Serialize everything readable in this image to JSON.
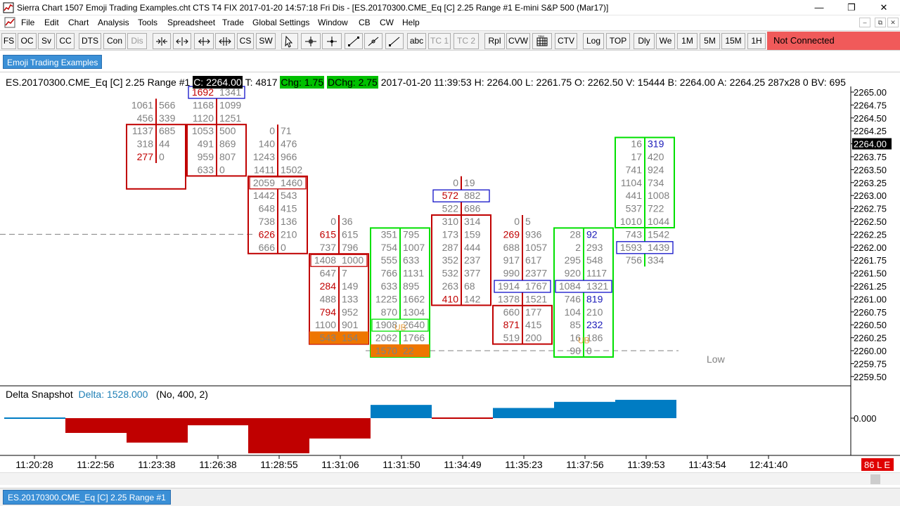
{
  "window": {
    "title": "Sierra Chart 1507 Emoji Trading Examples.cht  CTS T4 FIX 2017-01-20  14:57:18 Fri  Dis - [ES.20170300.CME_Eq [C]  2.25 Range  #1  E-mini S&P 500 (Mar17)]",
    "minimize": "—",
    "maximize": "❐",
    "close": "✕"
  },
  "menu": [
    "File",
    "Edit",
    "Chart",
    "Analysis",
    "Tools",
    "Spreadsheet",
    "Trade",
    "Global Settings",
    "Window",
    "CB",
    "CW",
    "Help"
  ],
  "mdi_controls": [
    "–",
    "⧉",
    "✕"
  ],
  "toolbar": {
    "buttons": [
      "FS",
      "OC",
      "Sv",
      "CC",
      "DTS",
      "Con",
      "Dis",
      "CS",
      "SW",
      "abc",
      "TC 1",
      "TC 2",
      "Rpl",
      "CVW",
      "CTV",
      "Log",
      "TOP",
      "Dly",
      "We",
      "1M",
      "5M",
      "15M",
      "1H"
    ],
    "disabled": [
      "Dis",
      "TC 1",
      "TC 2"
    ],
    "status": "Not Connected"
  },
  "chart_tab": "Emoji Trading Examples",
  "bottom_tab": "ES.20170300.CME_Eq [C]  2.25 Range  #1",
  "header": {
    "symbol": "ES.20170300.CME_Eq [C]  2.25 Range  #1",
    "close": "C: 2264.00",
    "trades": "T: 4817",
    "chg": "Chg: 1.75",
    "dchg": "DChg: 2.75",
    "rest": "2017-01-20 11:39:53 H: 2264.00 L: 2261.75 O: 2262.50 V: 15444 B: 2264.00 A: 2264.25 287x28 0 BV: 695"
  },
  "delta": {
    "title": "Delta Snapshot",
    "value": "Delta: 1528.000",
    "params": "(No, 400, 2)",
    "zero_label": "0.000"
  },
  "low_label": "Low",
  "right_badge": "86 L E",
  "colors": {
    "red": "#c00000",
    "green": "#00e000",
    "blue_box": "#1010c8",
    "blue_bar": "#007cc3",
    "orange": "#ee7600",
    "grey": "#808080",
    "blue_text": "#1a1ab8",
    "status_red": "#f05a5a"
  },
  "chart_data": {
    "type": "footprint",
    "price_axis": {
      "tick_labels": [
        "2265.00",
        "2264.75",
        "2264.50",
        "2264.25",
        "2264.00",
        "2263.75",
        "2263.50",
        "2263.25",
        "2263.00",
        "2262.75",
        "2262.50",
        "2262.25",
        "2262.00",
        "2261.75",
        "2261.50",
        "2261.25",
        "2261.00",
        "2260.75",
        "2260.50",
        "2260.25",
        "2260.00",
        "2259.75",
        "2259.50"
      ],
      "range": [
        2259.5,
        2265.0
      ],
      "step": 0.25,
      "current_price": "2264.00"
    },
    "time_axis": {
      "tick_labels": [
        "11:20:28",
        "11:22:56",
        "11:23:38",
        "11:26:38",
        "11:28:55",
        "11:31:06",
        "11:31:50",
        "11:34:49",
        "11:35:23",
        "11:37:56",
        "11:39:53",
        "11:43:54",
        "12:41:40"
      ]
    },
    "dashed_lines": [
      2262.25,
      2260.0
    ],
    "bars": [
      {
        "open": 2264.0,
        "close": 2264.25,
        "boxcolor": "red",
        "rows": [
          [
            "1061",
            "566"
          ],
          [
            "456",
            "339"
          ],
          [
            "1137",
            "685"
          ],
          [
            "318",
            "44"
          ],
          [
            "277",
            "0"
          ]
        ],
        "high": 2265.0,
        "colors": [
          [
            "g",
            "g"
          ],
          [
            "g",
            "g"
          ],
          [
            "g",
            "g"
          ],
          [
            "g",
            "g"
          ],
          [
            "r",
            "g"
          ]
        ],
        "boxes": []
      },
      {
        "high": 2265.0,
        "rows": [
          [
            "1692",
            "1341"
          ],
          [
            "1168",
            "1099"
          ],
          [
            "1120",
            "1251"
          ],
          [
            "1053",
            "500"
          ],
          [
            "491",
            "869"
          ],
          [
            "959",
            "807"
          ],
          [
            "633",
            "0"
          ]
        ],
        "colors": [
          [
            "r",
            "g"
          ],
          [
            "g",
            "g"
          ],
          [
            "g",
            "g"
          ],
          [
            "g",
            "g"
          ],
          [
            "g",
            "g"
          ],
          [
            "g",
            "g"
          ],
          [
            "g",
            "g"
          ]
        ],
        "body": [
          2264.25,
          2263.5
        ],
        "boxcolor": "red",
        "boxes": [
          {
            "row": 0,
            "color": "blue"
          }
        ]
      },
      {
        "high": 2264.25,
        "rows": [
          [
            "0",
            "71"
          ],
          [
            "140",
            "476"
          ],
          [
            "1243",
            "966"
          ],
          [
            "1411",
            "1502"
          ],
          [
            "2059",
            "1460"
          ],
          [
            "1442",
            "543"
          ],
          [
            "648",
            "415"
          ],
          [
            "738",
            "136"
          ],
          [
            "626",
            "210"
          ],
          [
            "666",
            "0"
          ]
        ],
        "colors": [
          [
            "g",
            "g"
          ],
          [
            "g",
            "g"
          ],
          [
            "g",
            "g"
          ],
          [
            "g",
            "g"
          ],
          [
            "g",
            "g"
          ],
          [
            "g",
            "g"
          ],
          [
            "g",
            "g"
          ],
          [
            "g",
            "g"
          ],
          [
            "r",
            "g"
          ],
          [
            "g",
            "g"
          ]
        ],
        "body": [
          2263.25,
          2262.0
        ],
        "boxcolor": "red",
        "boxes": [
          {
            "row": 4,
            "color": "red"
          }
        ]
      },
      {
        "high": 2262.5,
        "rows": [
          [
            "0",
            "36"
          ],
          [
            "615",
            "615"
          ],
          [
            "737",
            "796"
          ],
          [
            "1408",
            "1000"
          ],
          [
            "647",
            "7"
          ],
          [
            "284",
            "149"
          ],
          [
            "488",
            "133"
          ],
          [
            "794",
            "952"
          ],
          [
            "1100",
            "901"
          ],
          [
            "543",
            "154"
          ]
        ],
        "colors": [
          [
            "g",
            "g"
          ],
          [
            "r",
            "g"
          ],
          [
            "g",
            "g"
          ],
          [
            "g",
            "g"
          ],
          [
            "g",
            "g"
          ],
          [
            "r",
            "g"
          ],
          [
            "g",
            "g"
          ],
          [
            "r",
            "g"
          ],
          [
            "g",
            "g"
          ],
          [
            "g",
            "g"
          ]
        ],
        "body": [
          2261.75,
          2260.25
        ],
        "boxcolor": "red",
        "boxes": [
          {
            "row": 3,
            "color": "red"
          }
        ],
        "orange_row": 9
      },
      {
        "high": 2262.25,
        "rows": [
          [
            "351",
            "795"
          ],
          [
            "754",
            "1007"
          ],
          [
            "555",
            "633"
          ],
          [
            "766",
            "1131"
          ],
          [
            "633",
            "895"
          ],
          [
            "1225",
            "1662"
          ],
          [
            "870",
            "1304"
          ],
          [
            "1908",
            "2640"
          ],
          [
            "2062",
            "1766"
          ],
          [
            "1570",
            "22"
          ]
        ],
        "colors": [
          [
            "g",
            "g"
          ],
          [
            "g",
            "g"
          ],
          [
            "g",
            "g"
          ],
          [
            "g",
            "g"
          ],
          [
            "g",
            "g"
          ],
          [
            "g",
            "g"
          ],
          [
            "g",
            "g"
          ],
          [
            "g",
            "g"
          ],
          [
            "g",
            "g"
          ],
          [
            "g",
            "g"
          ]
        ],
        "body": [
          2262.25,
          2260.0
        ],
        "boxcolor": "green",
        "boxes": [
          {
            "row": 7,
            "color": "green"
          }
        ],
        "orange_row": 9,
        "ub_row": 7
      },
      {
        "high": 2263.25,
        "rows": [
          [
            "0",
            "19"
          ],
          [
            "572",
            "882"
          ],
          [
            "522",
            "686"
          ],
          [
            "310",
            "314"
          ],
          [
            "173",
            "159"
          ],
          [
            "287",
            "444"
          ],
          [
            "352",
            "237"
          ],
          [
            "532",
            "377"
          ],
          [
            "263",
            "68"
          ],
          [
            "410",
            "142"
          ]
        ],
        "colors": [
          [
            "g",
            "g"
          ],
          [
            "r",
            "g"
          ],
          [
            "g",
            "g"
          ],
          [
            "g",
            "g"
          ],
          [
            "g",
            "g"
          ],
          [
            "g",
            "g"
          ],
          [
            "g",
            "g"
          ],
          [
            "g",
            "g"
          ],
          [
            "g",
            "g"
          ],
          [
            "r",
            "g"
          ]
        ],
        "body": [
          2262.5,
          2261.0
        ],
        "boxcolor": "red",
        "boxes": [
          {
            "row": 1,
            "color": "blue"
          }
        ]
      },
      {
        "high": 2262.5,
        "rows": [
          [
            "0",
            "5"
          ],
          [
            "269",
            "936"
          ],
          [
            "688",
            "1057"
          ],
          [
            "917",
            "617"
          ],
          [
            "990",
            "2377"
          ],
          [
            "1914",
            "1767"
          ],
          [
            "1378",
            "1521"
          ],
          [
            "660",
            "177"
          ],
          [
            "871",
            "415"
          ],
          [
            "519",
            "200"
          ]
        ],
        "colors": [
          [
            "g",
            "g"
          ],
          [
            "r",
            "g"
          ],
          [
            "g",
            "g"
          ],
          [
            "g",
            "g"
          ],
          [
            "g",
            "g"
          ],
          [
            "g",
            "g"
          ],
          [
            "g",
            "g"
          ],
          [
            "g",
            "g"
          ],
          [
            "r",
            "g"
          ],
          [
            "g",
            "g"
          ]
        ],
        "body": [
          2260.75,
          2260.25
        ],
        "boxcolor": "red",
        "boxes": [
          {
            "row": 5,
            "color": "blue"
          }
        ]
      },
      {
        "high": 2262.25,
        "rows": [
          [
            "28",
            "92"
          ],
          [
            "2",
            "293"
          ],
          [
            "295",
            "548"
          ],
          [
            "920",
            "1117"
          ],
          [
            "1084",
            "1321"
          ],
          [
            "746",
            "819"
          ],
          [
            "104",
            "210"
          ],
          [
            "85",
            "232"
          ],
          [
            "16",
            "186"
          ],
          [
            "90",
            "0"
          ]
        ],
        "colors": [
          [
            "g",
            "b"
          ],
          [
            "g",
            "g"
          ],
          [
            "g",
            "g"
          ],
          [
            "g",
            "g"
          ],
          [
            "g",
            "g"
          ],
          [
            "g",
            "b"
          ],
          [
            "g",
            "g"
          ],
          [
            "g",
            "b"
          ],
          [
            "g",
            "g"
          ],
          [
            "g",
            "g"
          ]
        ],
        "body": [
          2262.25,
          2260.0
        ],
        "boxcolor": "green",
        "boxes": [
          {
            "row": 4,
            "color": "blue"
          }
        ],
        "ub_row": 8
      },
      {
        "high": 2264.0,
        "rows": [
          [
            "16",
            "319"
          ],
          [
            "17",
            "420"
          ],
          [
            "741",
            "924"
          ],
          [
            "1104",
            "734"
          ],
          [
            "441",
            "1008"
          ],
          [
            "537",
            "722"
          ],
          [
            "1010",
            "1044"
          ],
          [
            "743",
            "1542"
          ],
          [
            "1593",
            "1439"
          ],
          [
            "756",
            "334"
          ]
        ],
        "colors": [
          [
            "g",
            "b"
          ],
          [
            "g",
            "g"
          ],
          [
            "g",
            "g"
          ],
          [
            "g",
            "g"
          ],
          [
            "g",
            "g"
          ],
          [
            "g",
            "g"
          ],
          [
            "g",
            "g"
          ],
          [
            "g",
            "g"
          ],
          [
            "g",
            "g"
          ],
          [
            "g",
            "g"
          ]
        ],
        "body": [
          2264.0,
          2262.5
        ],
        "boxcolor": "green",
        "boxes": [
          {
            "row": 8,
            "color": "blue"
          }
        ]
      }
    ],
    "delta_bars": [
      {
        "value": 0,
        "sign": "pos"
      },
      {
        "value": -290,
        "sign": "neg"
      },
      {
        "value": -480,
        "sign": "neg"
      },
      {
        "value": -140,
        "sign": "neg"
      },
      {
        "value": -690,
        "sign": "neg"
      },
      {
        "value": -400,
        "sign": "neg"
      },
      {
        "value": 260,
        "sign": "pos"
      },
      {
        "value": 0,
        "sign": "neg"
      },
      {
        "value": 200,
        "sign": "pos"
      },
      {
        "value": 320,
        "sign": "pos"
      },
      {
        "value": 360,
        "sign": "pos"
      }
    ]
  }
}
